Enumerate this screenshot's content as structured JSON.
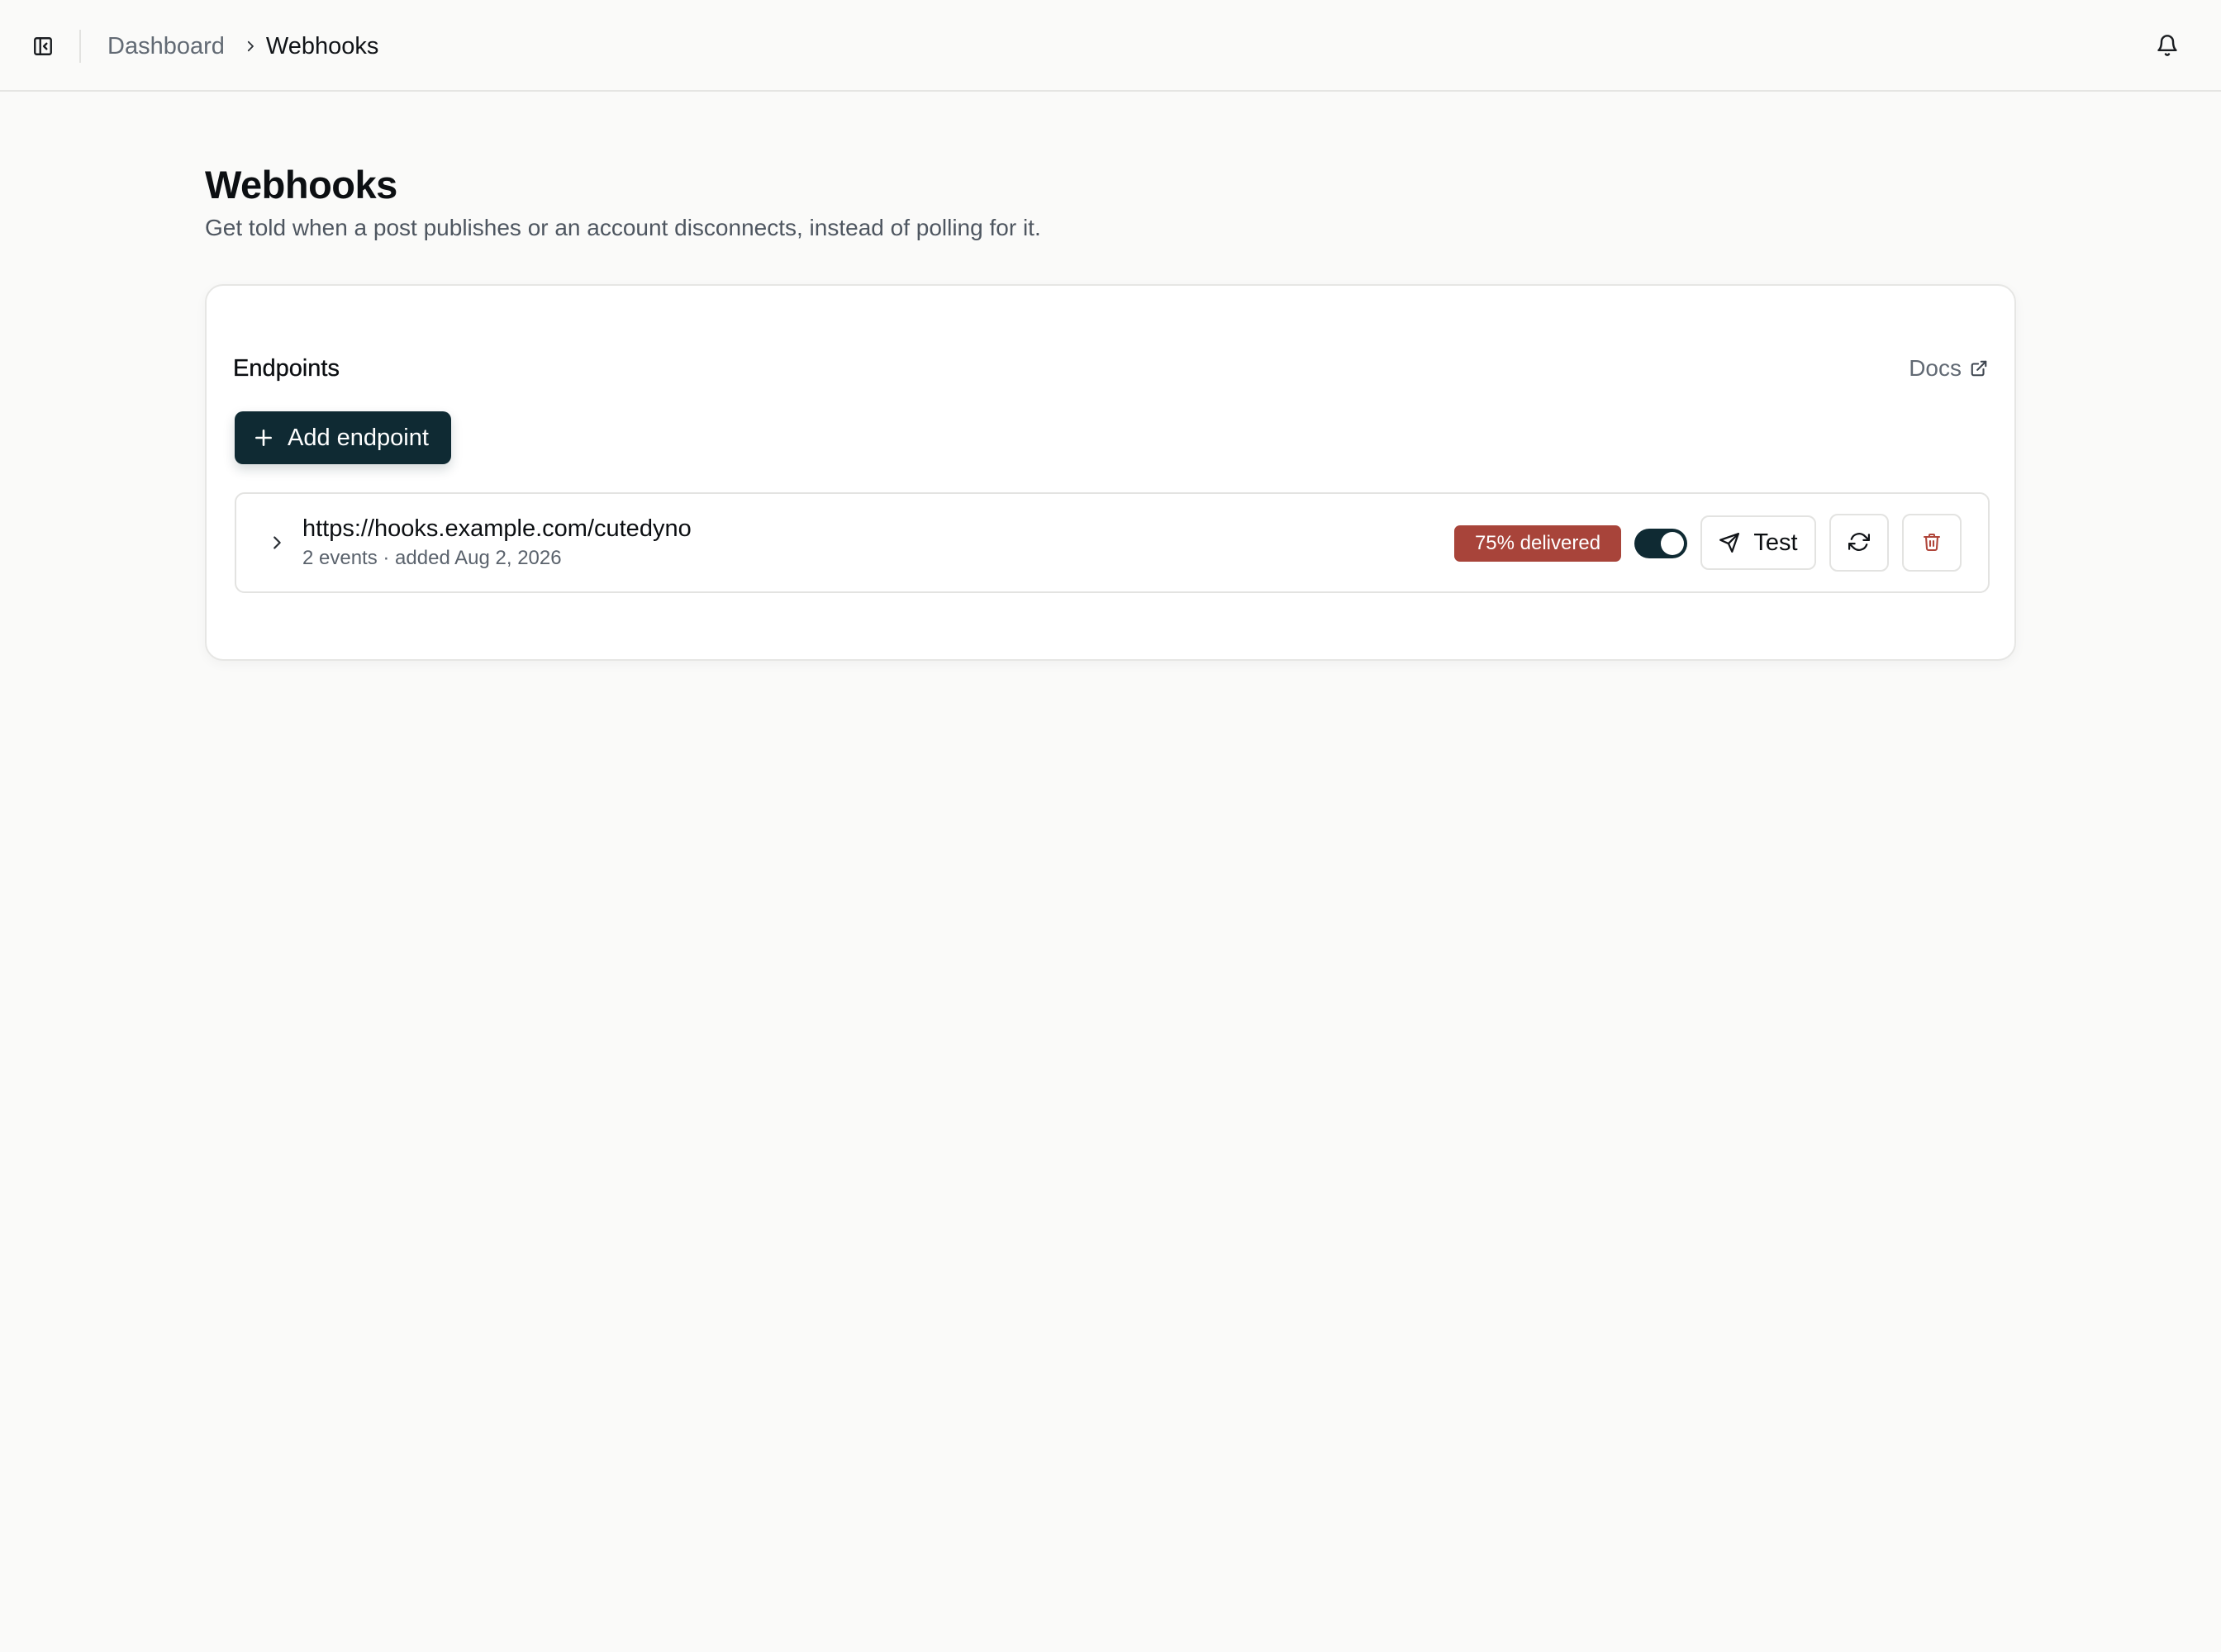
{
  "header": {
    "breadcrumb_parent": "Dashboard",
    "breadcrumb_current": "Webhooks",
    "icons": {
      "sidebar_toggle": "sidebar-toggle-icon",
      "chevron": "chevron-right-icon",
      "notifications": "bell-icon"
    }
  },
  "page": {
    "title": "Webhooks",
    "subtitle": "Get told when a post publishes or an account disconnects, instead of polling for it."
  },
  "endpoints_card": {
    "heading": "Endpoints",
    "docs_label": "Docs",
    "add_button_label": "Add endpoint",
    "endpoints": [
      {
        "url": "https://hooks.example.com/cutedyno",
        "meta": "2 events · added Aug 2, 2026",
        "delivery_badge": "75% delivered",
        "enabled": true,
        "test_label": "Test"
      }
    ]
  },
  "colors": {
    "primary": "#0f2a33",
    "badge_danger": "#a8443a",
    "delete_icon": "#b0463b",
    "background": "#fafaf9",
    "muted_text": "#626a74"
  }
}
